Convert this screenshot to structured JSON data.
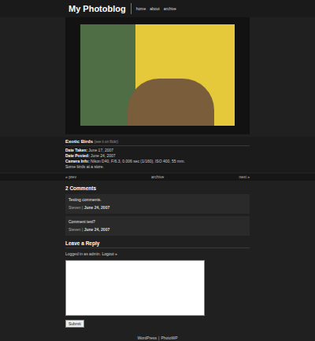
{
  "header": {
    "title": "My Photoblog",
    "nav": [
      "home",
      "about",
      "archive"
    ]
  },
  "post": {
    "title": "Exotic Birds",
    "flickr": "(see it on flickr)",
    "meta": [
      {
        "label": "Date Taken:",
        "value": "June 17, 2007"
      },
      {
        "label": "Date Posted:",
        "value": "June 24, 2007"
      },
      {
        "label": "Camera Info:",
        "value": "Nikon D40, F/6.3, 0.006 sec (1/160), ISO 400, 55 mm."
      }
    ],
    "caption": "Some birds at a store."
  },
  "pager": {
    "prev": "« prev",
    "archive": "archive",
    "next": "next »"
  },
  "comments": {
    "heading": "2 Comments",
    "items": [
      {
        "text": "Testing comments.",
        "author": "Steven",
        "separator": "|",
        "date": "June 24, 2007"
      },
      {
        "text": "Comment test?",
        "author": "Steven",
        "separator": "|",
        "date": "June 24, 2007"
      }
    ]
  },
  "reply": {
    "heading": "Leave a Reply",
    "logged_in": "Logged in as admin.",
    "logout": "Logout »",
    "submit": "Submit"
  },
  "footer": {
    "left": "WordPress",
    "separator": "|",
    "right": "PhotoWP"
  }
}
